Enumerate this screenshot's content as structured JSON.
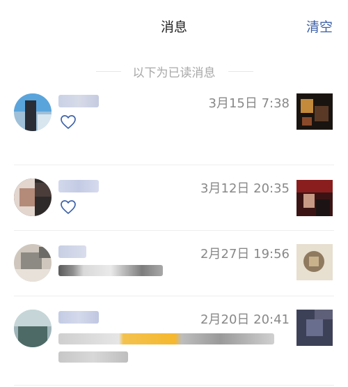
{
  "header": {
    "title": "消息",
    "clear_label": "清空"
  },
  "divider": {
    "label": "以下为已读消息"
  },
  "messages": [
    {
      "time": "3月15日 7:38",
      "type": "like",
      "icon": "heart-outline-icon"
    },
    {
      "time": "3月12日 20:35",
      "type": "like",
      "icon": "heart-outline-icon"
    },
    {
      "time": "2月27日 19:56",
      "type": "comment"
    },
    {
      "time": "2月20日 20:41",
      "type": "comment"
    }
  ],
  "colors": {
    "accent": "#3c61a8",
    "heart": "#3c61a8",
    "muted": "#888888"
  }
}
